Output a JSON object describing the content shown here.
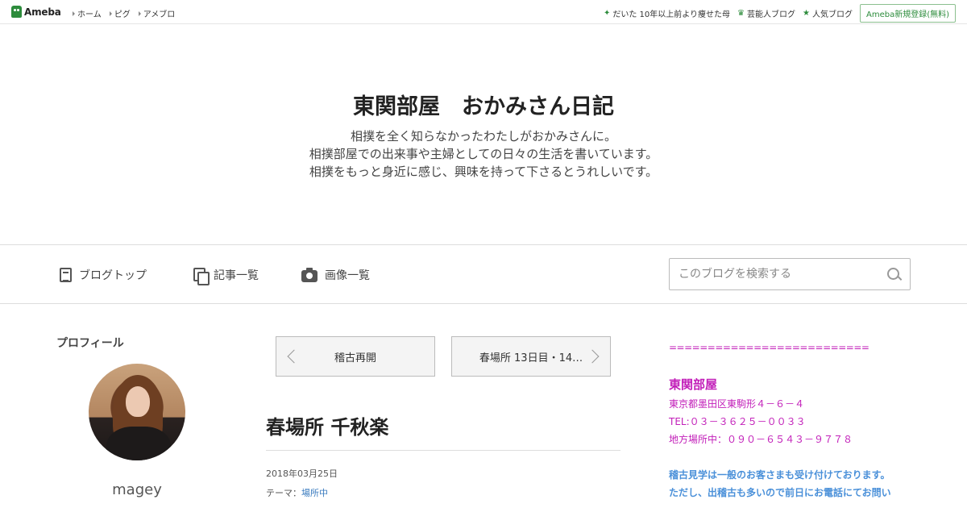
{
  "topbar": {
    "logo_text": "Ameba",
    "nav": [
      "ホーム",
      "ピグ",
      "アメブロ"
    ],
    "right_items": [
      {
        "icon": "sparkle-icon",
        "label": "だいた 10年以上前より痩せた母"
      },
      {
        "icon": "crown-icon",
        "label": "芸能人ブログ"
      },
      {
        "icon": "star-icon",
        "label": "人気ブログ"
      }
    ],
    "register_label": "Ameba新規登録(無料)"
  },
  "header": {
    "title": "東関部屋　おかみさん日記",
    "description": [
      "相撲を全く知らなかったわたしがおかみさんに。",
      "相撲部屋での出来事や主婦としての日々の生活を書いています。",
      "相撲をもっと身近に感じ、興味を持って下さるとうれしいです。"
    ]
  },
  "blognav": {
    "top_label": "ブログトップ",
    "list_label": "記事一覧",
    "images_label": "画像一覧",
    "search_placeholder": "このブログを検索する"
  },
  "profile": {
    "heading": "プロフィール",
    "username": "magey"
  },
  "pager": {
    "prev_label": "稽古再開",
    "next_label": "春場所 13日目・14…"
  },
  "entry": {
    "title": "春場所 千秋楽",
    "date": "2018年03月25日",
    "theme_prefix": "テーマ：",
    "theme": "場所中"
  },
  "sidebar": {
    "divider": "==========================",
    "name": "東関部屋",
    "address": "東京都墨田区東駒形４－６－４",
    "tel": "TEL:０３－３６２５－００３３",
    "mobile": "地方場所中：０９０－６５４３－９７７８",
    "note1": "稽古見学は一般のお客さまも受け付けております。",
    "note2": "ただし、出稽古も多いので前日にお電話にてお問い",
    "colors": {
      "magenta": "#c21fb9",
      "blue": "#4a90d9",
      "brand_green": "#2d8c3c"
    }
  }
}
